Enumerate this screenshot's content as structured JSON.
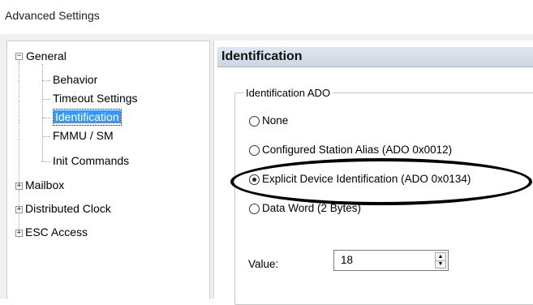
{
  "window": {
    "title": "Advanced Settings"
  },
  "tree": {
    "items": [
      {
        "label": "General",
        "expander": "⊟",
        "expanded": true
      },
      {
        "label": "Behavior"
      },
      {
        "label": "Timeout Settings"
      },
      {
        "label": "Identification",
        "selected": true
      },
      {
        "label": "FMMU / SM"
      },
      {
        "label": "Init Commands"
      },
      {
        "label": "Mailbox",
        "expander": "⊞",
        "expanded": false
      },
      {
        "label": "Distributed Clock",
        "expander": "⊞",
        "expanded": false
      },
      {
        "label": "ESC Access",
        "expander": "⊞",
        "expanded": false
      }
    ]
  },
  "panel": {
    "header": "Identification",
    "group_title": "Identification ADO",
    "options": [
      {
        "label": "None",
        "checked": false
      },
      {
        "label": "Configured Station Alias (ADO 0x0012)",
        "checked": false
      },
      {
        "label": "Explicit Device Identification (ADO 0x0134)",
        "checked": true
      },
      {
        "label": "Data Word (2 Bytes)",
        "checked": false
      }
    ],
    "value_label": "Value:",
    "value": "18"
  }
}
